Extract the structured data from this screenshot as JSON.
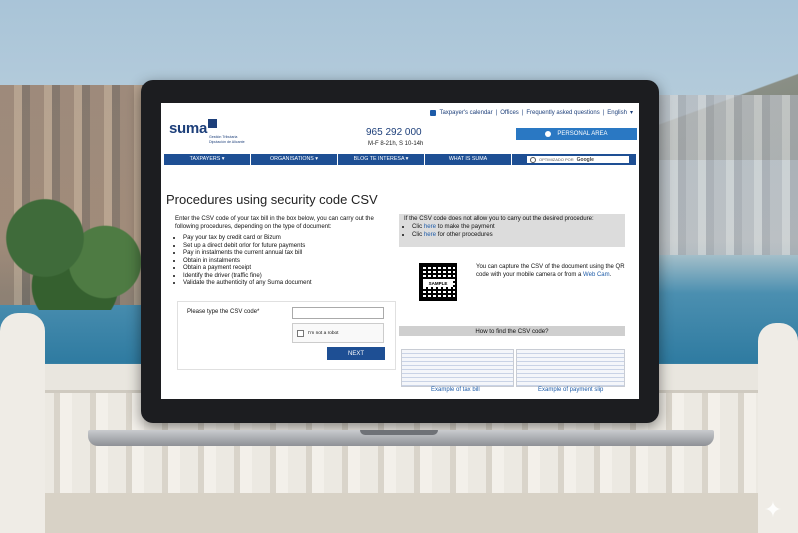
{
  "topbar": {
    "calendar": "Taxpayer's calendar",
    "offices": "Offices",
    "faq": "Frequently asked questions",
    "language": "English",
    "sep": "|"
  },
  "logo": {
    "word": "suma",
    "sub_line1": "Gestión Tributaria",
    "sub_line2": "Diputación de Alicante"
  },
  "contact": {
    "phone": "965 292 000",
    "hours": "M-F 8-21h, S 10-14h"
  },
  "personal_area": "PERSONAL AREA",
  "nav": {
    "items": [
      "TAXPAYERS ▾",
      "ORGANISATIONS ▾",
      "BLOG TE INTERESA ▾",
      "WHAT IS SUMA"
    ],
    "search_hint": "OPTIMIZADO POR",
    "search_brand": "Google"
  },
  "page": {
    "title": "Procedures using security code CSV",
    "intro": "Enter the CSV code of your tax bill in the box below, you can carry out the following procedures, depending on the type of document:",
    "bullets": [
      "Pay your tax by credit card or Bizum",
      "Set up a direct debit orlor for future payments",
      "Pay in instalments the current annual tax bill",
      "Obtain in instalments",
      "Obtain a payment receipt",
      "Identify the driver (traffic fine)",
      "Validate the authenticity of any Suma document"
    ],
    "csv_label": "Please type the CSV code*",
    "captcha": "I'm not a robot",
    "next": "NEXT"
  },
  "help": {
    "notice": "If the CSV code does not allow you to carry out the desired procedure:",
    "line1_pre": "Clic ",
    "line1_link": "here",
    "line1_post": " to make the payment",
    "line2_pre": "Clic ",
    "line2_link": "here",
    "line2_post": " for other procedures",
    "qr_label": "SAMPLE",
    "qr_text": "You can capture the CSV of the document using the QR code with your mobile camera or from a ",
    "qr_link": "Web Cam",
    "qr_end": ".",
    "find": "How to find the CSV code?",
    "example_bill": "Example of tax bill",
    "example_slip": "Example of payment slip"
  }
}
